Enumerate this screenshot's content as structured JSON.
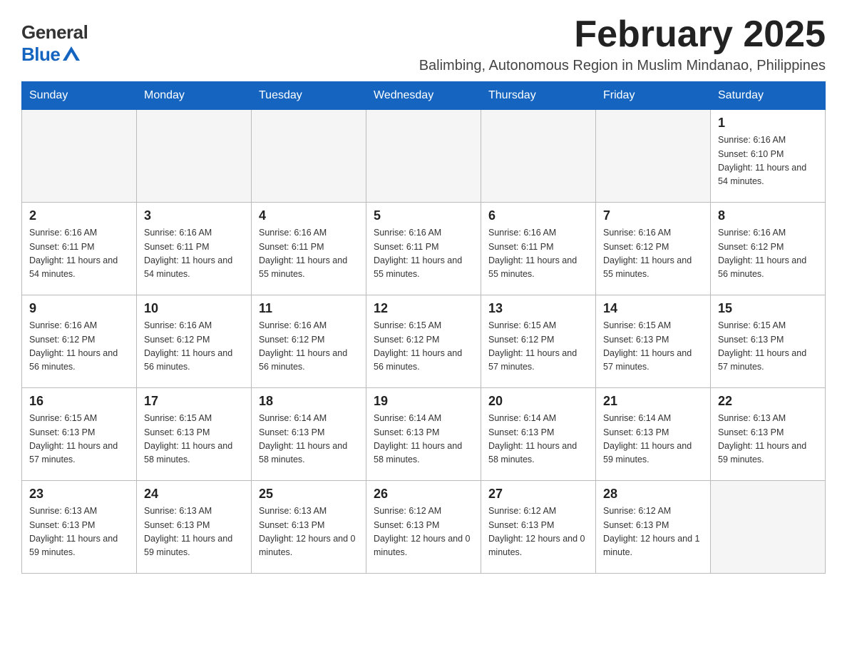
{
  "logo": {
    "general": "General",
    "blue": "Blue"
  },
  "title": "February 2025",
  "subtitle": "Balimbing, Autonomous Region in Muslim Mindanao, Philippines",
  "days_of_week": [
    "Sunday",
    "Monday",
    "Tuesday",
    "Wednesday",
    "Thursday",
    "Friday",
    "Saturday"
  ],
  "weeks": [
    [
      {
        "day": "",
        "info": ""
      },
      {
        "day": "",
        "info": ""
      },
      {
        "day": "",
        "info": ""
      },
      {
        "day": "",
        "info": ""
      },
      {
        "day": "",
        "info": ""
      },
      {
        "day": "",
        "info": ""
      },
      {
        "day": "1",
        "info": "Sunrise: 6:16 AM\nSunset: 6:10 PM\nDaylight: 11 hours and 54 minutes."
      }
    ],
    [
      {
        "day": "2",
        "info": "Sunrise: 6:16 AM\nSunset: 6:11 PM\nDaylight: 11 hours and 54 minutes."
      },
      {
        "day": "3",
        "info": "Sunrise: 6:16 AM\nSunset: 6:11 PM\nDaylight: 11 hours and 54 minutes."
      },
      {
        "day": "4",
        "info": "Sunrise: 6:16 AM\nSunset: 6:11 PM\nDaylight: 11 hours and 55 minutes."
      },
      {
        "day": "5",
        "info": "Sunrise: 6:16 AM\nSunset: 6:11 PM\nDaylight: 11 hours and 55 minutes."
      },
      {
        "day": "6",
        "info": "Sunrise: 6:16 AM\nSunset: 6:11 PM\nDaylight: 11 hours and 55 minutes."
      },
      {
        "day": "7",
        "info": "Sunrise: 6:16 AM\nSunset: 6:12 PM\nDaylight: 11 hours and 55 minutes."
      },
      {
        "day": "8",
        "info": "Sunrise: 6:16 AM\nSunset: 6:12 PM\nDaylight: 11 hours and 56 minutes."
      }
    ],
    [
      {
        "day": "9",
        "info": "Sunrise: 6:16 AM\nSunset: 6:12 PM\nDaylight: 11 hours and 56 minutes."
      },
      {
        "day": "10",
        "info": "Sunrise: 6:16 AM\nSunset: 6:12 PM\nDaylight: 11 hours and 56 minutes."
      },
      {
        "day": "11",
        "info": "Sunrise: 6:16 AM\nSunset: 6:12 PM\nDaylight: 11 hours and 56 minutes."
      },
      {
        "day": "12",
        "info": "Sunrise: 6:15 AM\nSunset: 6:12 PM\nDaylight: 11 hours and 56 minutes."
      },
      {
        "day": "13",
        "info": "Sunrise: 6:15 AM\nSunset: 6:12 PM\nDaylight: 11 hours and 57 minutes."
      },
      {
        "day": "14",
        "info": "Sunrise: 6:15 AM\nSunset: 6:13 PM\nDaylight: 11 hours and 57 minutes."
      },
      {
        "day": "15",
        "info": "Sunrise: 6:15 AM\nSunset: 6:13 PM\nDaylight: 11 hours and 57 minutes."
      }
    ],
    [
      {
        "day": "16",
        "info": "Sunrise: 6:15 AM\nSunset: 6:13 PM\nDaylight: 11 hours and 57 minutes."
      },
      {
        "day": "17",
        "info": "Sunrise: 6:15 AM\nSunset: 6:13 PM\nDaylight: 11 hours and 58 minutes."
      },
      {
        "day": "18",
        "info": "Sunrise: 6:14 AM\nSunset: 6:13 PM\nDaylight: 11 hours and 58 minutes."
      },
      {
        "day": "19",
        "info": "Sunrise: 6:14 AM\nSunset: 6:13 PM\nDaylight: 11 hours and 58 minutes."
      },
      {
        "day": "20",
        "info": "Sunrise: 6:14 AM\nSunset: 6:13 PM\nDaylight: 11 hours and 58 minutes."
      },
      {
        "day": "21",
        "info": "Sunrise: 6:14 AM\nSunset: 6:13 PM\nDaylight: 11 hours and 59 minutes."
      },
      {
        "day": "22",
        "info": "Sunrise: 6:13 AM\nSunset: 6:13 PM\nDaylight: 11 hours and 59 minutes."
      }
    ],
    [
      {
        "day": "23",
        "info": "Sunrise: 6:13 AM\nSunset: 6:13 PM\nDaylight: 11 hours and 59 minutes."
      },
      {
        "day": "24",
        "info": "Sunrise: 6:13 AM\nSunset: 6:13 PM\nDaylight: 11 hours and 59 minutes."
      },
      {
        "day": "25",
        "info": "Sunrise: 6:13 AM\nSunset: 6:13 PM\nDaylight: 12 hours and 0 minutes."
      },
      {
        "day": "26",
        "info": "Sunrise: 6:12 AM\nSunset: 6:13 PM\nDaylight: 12 hours and 0 minutes."
      },
      {
        "day": "27",
        "info": "Sunrise: 6:12 AM\nSunset: 6:13 PM\nDaylight: 12 hours and 0 minutes."
      },
      {
        "day": "28",
        "info": "Sunrise: 6:12 AM\nSunset: 6:13 PM\nDaylight: 12 hours and 1 minute."
      },
      {
        "day": "",
        "info": ""
      }
    ]
  ]
}
